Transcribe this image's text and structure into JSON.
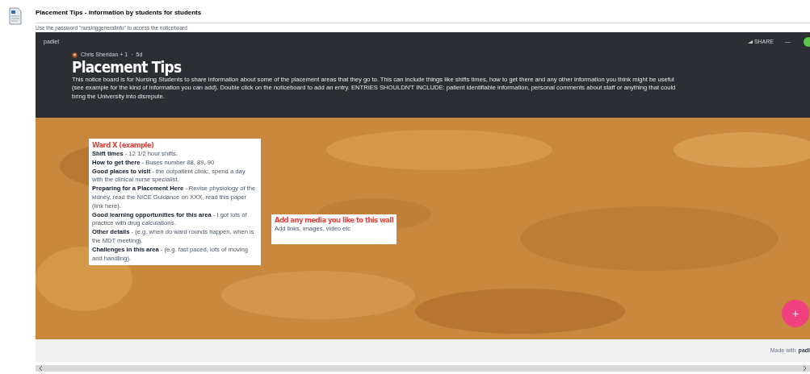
{
  "page": {
    "title": "Placement Tips - information by students for students",
    "note": "Use the password \"nursinggeneralinfo\" to access the noticeboard"
  },
  "padlet": {
    "brand": "padlet",
    "share": "SHARE",
    "menu": "—",
    "author": "Chris Sheridan + 1",
    "separator": "·",
    "age": "5d",
    "title": "Placement Tips",
    "description_lines": [
      "This notice board is for Nursing Students to share information about some of the placement areas that they go to. This can include things like shifts times, how to get there and any other information you think might be useful",
      "(see example for the kind of information you can add). Double click on the noticeboard to add an entry. ENTRIES SHOULDN'T INCLUDE: patient identifiable information, personal comments about staff or anything that could",
      "bring the University into disrepute."
    ]
  },
  "posts": [
    {
      "title": "Ward X (example)",
      "items": [
        "**Shift times** - 12 1/2 hour shifts.",
        "**How to get there** - Buses number 88, 89, 90",
        "**Good places to visit** - the outpatient clinic, spend a day with the clinical nurse specialist.",
        "**Preparing for a Placement Here** - Revise physiology of the kidney, read the NICE Guidance on XXX, read this paper (link here).",
        "**Good learning opportunities for this area** - I got lots of practice with drug calculations.",
        "**Other details** - (e.g. when do ward rounds happen, when is the MDT meeting).",
        "**Challenges in this area** - (e.g. fast paced, lots of moving and handling)."
      ]
    },
    {
      "title": "Add any media you like to this wall",
      "items": [
        "Add links, images, video etc"
      ]
    }
  ],
  "add_button": "+",
  "footer": {
    "made_with": "Made with",
    "brand": "padl"
  }
}
